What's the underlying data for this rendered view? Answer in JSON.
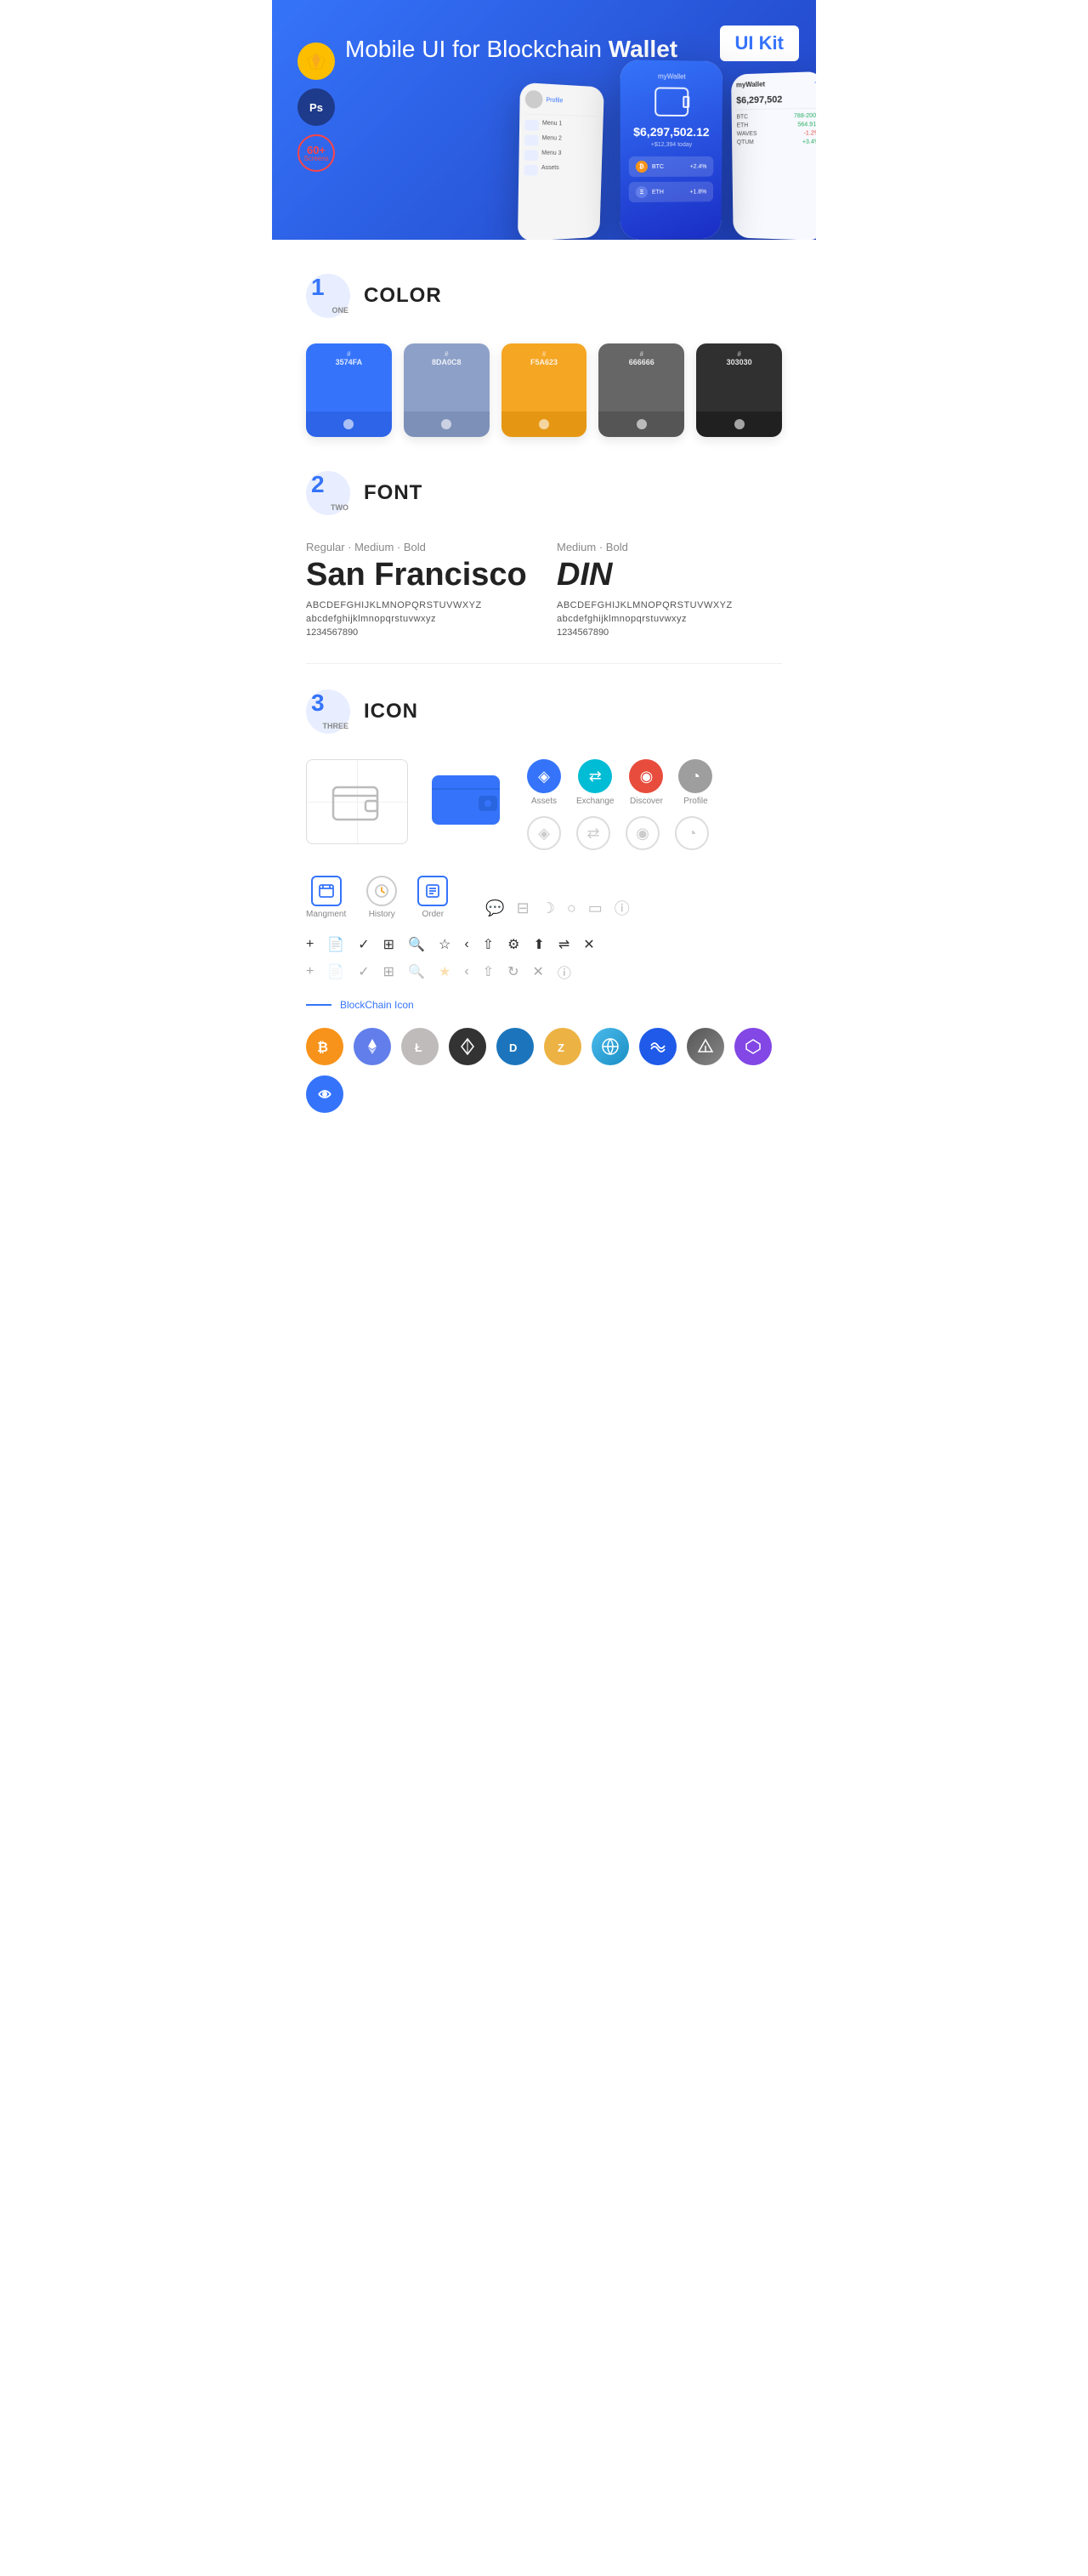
{
  "hero": {
    "title": "Mobile UI for Blockchain ",
    "title_bold": "Wallet",
    "badge": "UI Kit",
    "tool_sketch": "S",
    "tool_ps": "Ps",
    "screens_label": "60+",
    "screens_sub": "Screens"
  },
  "section1": {
    "number": "1",
    "sub": "ONE",
    "title": "COLOR",
    "colors": [
      {
        "hex": "#3574FA",
        "code": "3574FA"
      },
      {
        "hex": "#8DA0C8",
        "code": "8DA0C8"
      },
      {
        "hex": "#F5A623",
        "code": "F5A623"
      },
      {
        "hex": "#666666",
        "code": "666666"
      },
      {
        "hex": "#303030",
        "code": "303030"
      }
    ]
  },
  "section2": {
    "number": "2",
    "sub": "TWO",
    "title": "FONT",
    "font1": {
      "style": "Regular · Medium · Bold",
      "name": "San Francisco",
      "upper": "ABCDEFGHIJKLMNOPQRSTUVWXYZ",
      "lower": "abcdefghijklmnopqrstuvwxyz",
      "numbers": "1234567890"
    },
    "font2": {
      "style": "Medium · Bold",
      "name": "DIN",
      "upper": "ABCDEFGHIJKLMNOPQRSTUVWXYZ",
      "lower": "abcdefghijklmnopqrstuvwxyz",
      "numbers": "1234567890"
    }
  },
  "section3": {
    "number": "3",
    "sub": "THREE",
    "title": "ICON",
    "nav_icons": [
      {
        "label": "Assets",
        "color": "#3574FA"
      },
      {
        "label": "Exchange",
        "color": "#00BCD4"
      },
      {
        "label": "Discover",
        "color": "#e74c3c"
      },
      {
        "label": "Profile",
        "color": "#9E9E9E"
      }
    ],
    "bottom_icons": [
      {
        "label": "Mangment"
      },
      {
        "label": "History"
      },
      {
        "label": "Order"
      }
    ],
    "blockchain_label": "BlockChain Icon",
    "crypto_coins": [
      {
        "label": "BTC",
        "color": "#F7931A"
      },
      {
        "label": "ETH",
        "color": "#627EEA"
      },
      {
        "label": "LTC",
        "color": "#B8B8B8"
      },
      {
        "label": "NEO",
        "color": "#58BF00"
      },
      {
        "label": "DASH",
        "color": "#1C75BC"
      },
      {
        "label": "ZEC",
        "color": "#ECB244"
      },
      {
        "label": "NET",
        "color": "#4BBAEB"
      },
      {
        "label": "WAVES",
        "color": "#1F5AE8"
      },
      {
        "label": "XMR",
        "color": "#FF6600"
      },
      {
        "label": "POL",
        "color": "#8247E5"
      },
      {
        "label": "DF",
        "color": "#3574FA"
      }
    ]
  }
}
